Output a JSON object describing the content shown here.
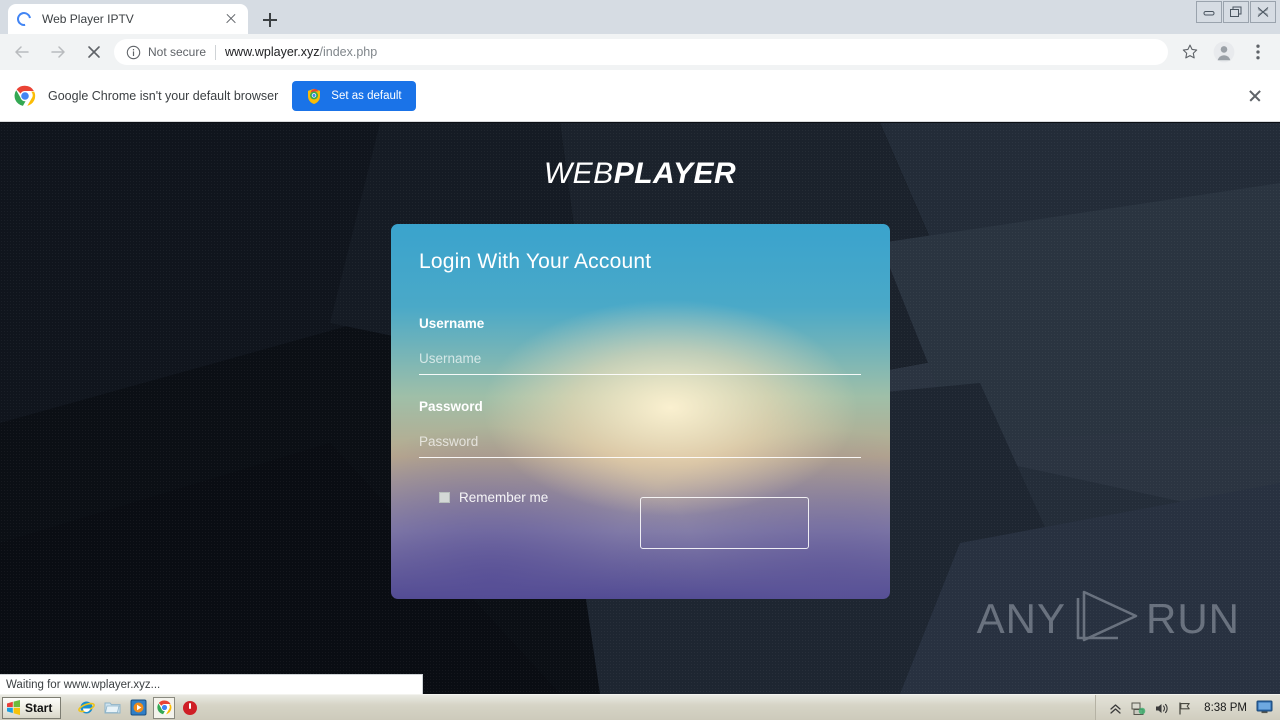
{
  "browser": {
    "tab": {
      "title": "Web Player IPTV",
      "state": "loading"
    },
    "new_tab_label": "+",
    "window_controls": [
      "minimize",
      "restore",
      "close"
    ],
    "nav": {
      "back": "back-arrow",
      "forward": "forward-arrow",
      "stop": "stop-x"
    },
    "omnibox": {
      "security_label": "Not secure",
      "url_host": "www.wplayer.xyz",
      "url_path": "/index.php",
      "full_url": "www.wplayer.xyz/index.php"
    },
    "toolbar_icons": [
      "bookmark-star-icon",
      "profile-avatar-icon",
      "three-dot-menu-icon"
    ]
  },
  "infobar": {
    "message": "Google Chrome isn't your default browser",
    "button_label": "Set as default",
    "close_label": "×"
  },
  "page": {
    "brand": {
      "part1": "WEB",
      "part2": "PLAYER"
    },
    "card": {
      "title": "Login With Your Account",
      "username_label": "Username",
      "username_placeholder": "Username",
      "username_value": "",
      "password_label": "Password",
      "password_placeholder": "Password",
      "password_value": "",
      "remember_label": "Remember me",
      "remember_checked": false,
      "submit_label": ""
    },
    "watermark": {
      "left": "ANY",
      "right": "RUN"
    }
  },
  "status": {
    "text": "Waiting for www.wplayer.xyz..."
  },
  "taskbar": {
    "start_label": "Start",
    "quick_launch": [
      "internet-explorer-icon",
      "folder-icon",
      "media-player-icon",
      "google-chrome-icon",
      "power-shutdown-icon"
    ],
    "tray_icons": [
      "show-hidden-icon",
      "network-icon",
      "volume-icon",
      "flag-icon",
      "display-icon"
    ],
    "clock": "8:38 PM"
  },
  "colors": {
    "accent_blue": "#1a73e8",
    "page_dark": "#171d26",
    "card_top": "#3aa3cd",
    "card_bottom": "#514b93",
    "taskbar": "#d6d4c6"
  }
}
